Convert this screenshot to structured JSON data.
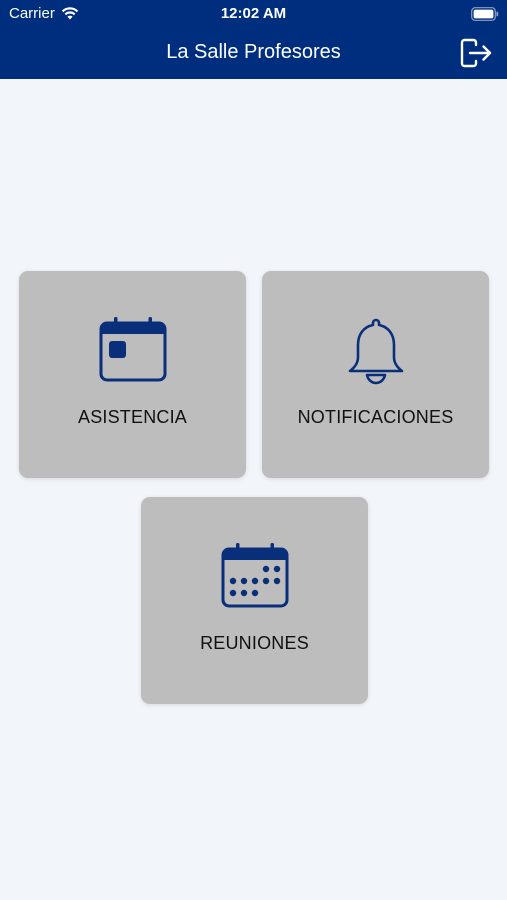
{
  "status_bar": {
    "carrier": "Carrier",
    "time": "12:02 AM"
  },
  "header": {
    "title": "La Salle Profesores",
    "logout_icon": "logout-icon"
  },
  "tiles": [
    {
      "label": "ASISTENCIA",
      "icon": "calendar-icon"
    },
    {
      "label": "NOTIFICACIONES",
      "icon": "bell-icon"
    },
    {
      "label": "REUNIONES",
      "icon": "calendar-dots-icon"
    }
  ],
  "colors": {
    "header_bg": "#002e7f",
    "icon": "#0a2f7a",
    "tile_bg": "#bdbdbd",
    "page_bg": "#f2f5fa"
  }
}
